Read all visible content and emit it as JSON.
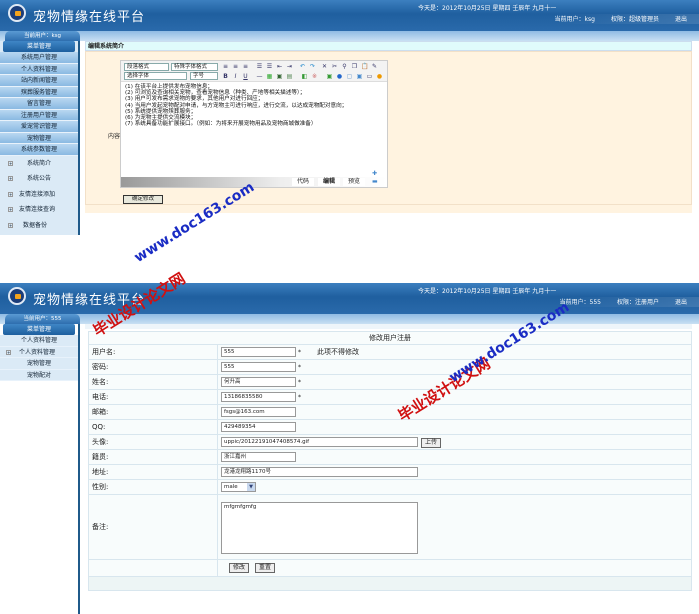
{
  "app": {
    "title": "宠物情缘在线平台",
    "date": "今天是：2012年10月25日 星期四 壬辰年 九月十一",
    "logout": "退出"
  },
  "admin": {
    "current_user": "当前用户：ksg",
    "user_label": "当前用户：ksg",
    "role": "权限：超级管理员",
    "menu_header": "菜单管理",
    "menu_items": [
      "系统用户管理",
      "个人资料管理",
      "站内新闻管理",
      "殡葬服务管理",
      "留言管理",
      "注册用户管理",
      "爱宠常识管理",
      "宠物管理",
      "系统参数管理"
    ],
    "sub_items": [
      "系统简介",
      "系统公告",
      "友情连接添加",
      "友情连接查询",
      "数据备份"
    ],
    "page_title": "编辑系统简介",
    "content_label": "内容",
    "editor": {
      "paragraph_format": "段落格式",
      "special_format": "特殊字体格式",
      "font": "选择字体",
      "size": "字号",
      "lines": [
        "(1) 在该平台上提供发布宠物信息；",
        "(2) 可浏览及查询相关宠物，查看宠物信息（种类、产地等相关描述等）；",
        "(3) 用户可发布需求宠物的要求，其他用户对进行回应；",
        "(4) 当用户发起宠物配对申请，与方宠物主可进行响应，进行交流，以达成宠物配对意向；",
        "(5) 系统提供宠物殡葬服务；",
        "(6) 为宠物主提供交流模块；",
        "(7) 系统具备功能扩展接口。（例如：为将来开展宠物用品及宠物商城做准备）"
      ],
      "tabs": [
        "代码",
        "编辑",
        "预览"
      ]
    },
    "submit": "确定修改"
  },
  "user": {
    "current_user": "当前用户：555",
    "user_label": "当前用户：555",
    "role": "权限：注册用户",
    "menu_header": "菜单管理",
    "menu_items": [
      "个人资料管理",
      "个人资料管理",
      "宠物管理",
      "宠物配对"
    ],
    "form_title": "修改用户注册",
    "fields": {
      "username": {
        "label": "用户名:",
        "value": "555",
        "note": "此项不得修改"
      },
      "password": {
        "label": "密码:",
        "value": "555"
      },
      "name": {
        "label": "姓名:",
        "value": "何升高"
      },
      "phone": {
        "label": "电话:",
        "value": "13186835580"
      },
      "email": {
        "label": "邮箱:",
        "value": "fsgs@163.com"
      },
      "qq": {
        "label": "QQ:",
        "value": "429489354"
      },
      "avatar": {
        "label": "头像:",
        "value": "uppic/20122191047408574.gif",
        "upload": "上传"
      },
      "hometown": {
        "label": "籍贯:",
        "value": "浙江嘉州"
      },
      "address": {
        "label": "地址:",
        "value": "龙港龙翔路1170号"
      },
      "gender": {
        "label": "性别:",
        "value": "male"
      },
      "remark": {
        "label": "备注:",
        "value": "mfgmfgmfg"
      }
    },
    "required_mark": "*",
    "buttons": {
      "modify": "修改",
      "reset": "重置"
    }
  },
  "watermark": {
    "cn": "毕业设计论文网",
    "url": "www.doc163.com"
  }
}
